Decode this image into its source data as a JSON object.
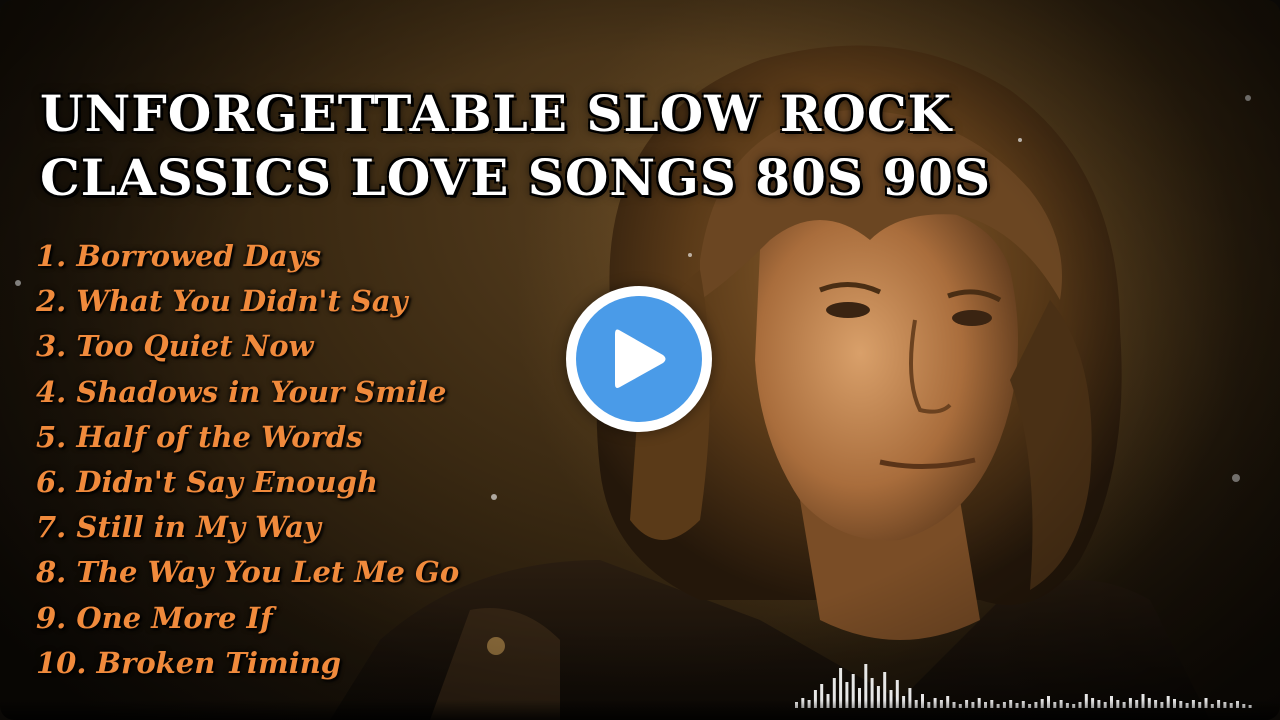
{
  "title": {
    "line1": "UNFORGETTABLE SLOW ROCK",
    "line2": "CLASSICS LOVE SONGS 80S 90S"
  },
  "tracks": [
    "1. Borrowed Days",
    "2. What You Didn't Say",
    "3. Too Quiet Now",
    "4. Shadows in Your Smile",
    "5. Half of the Words",
    "6. Didn't Say Enough",
    "7. Still in My Way",
    "8. The Way You Let Me Go",
    "9. One More If",
    "10. Broken Timing"
  ],
  "play_button": {
    "icon": "play-icon",
    "color": "#4a9be8"
  },
  "colors": {
    "title": "#ffffff",
    "tracks": "#f08a3c",
    "background": "#3a2912"
  }
}
